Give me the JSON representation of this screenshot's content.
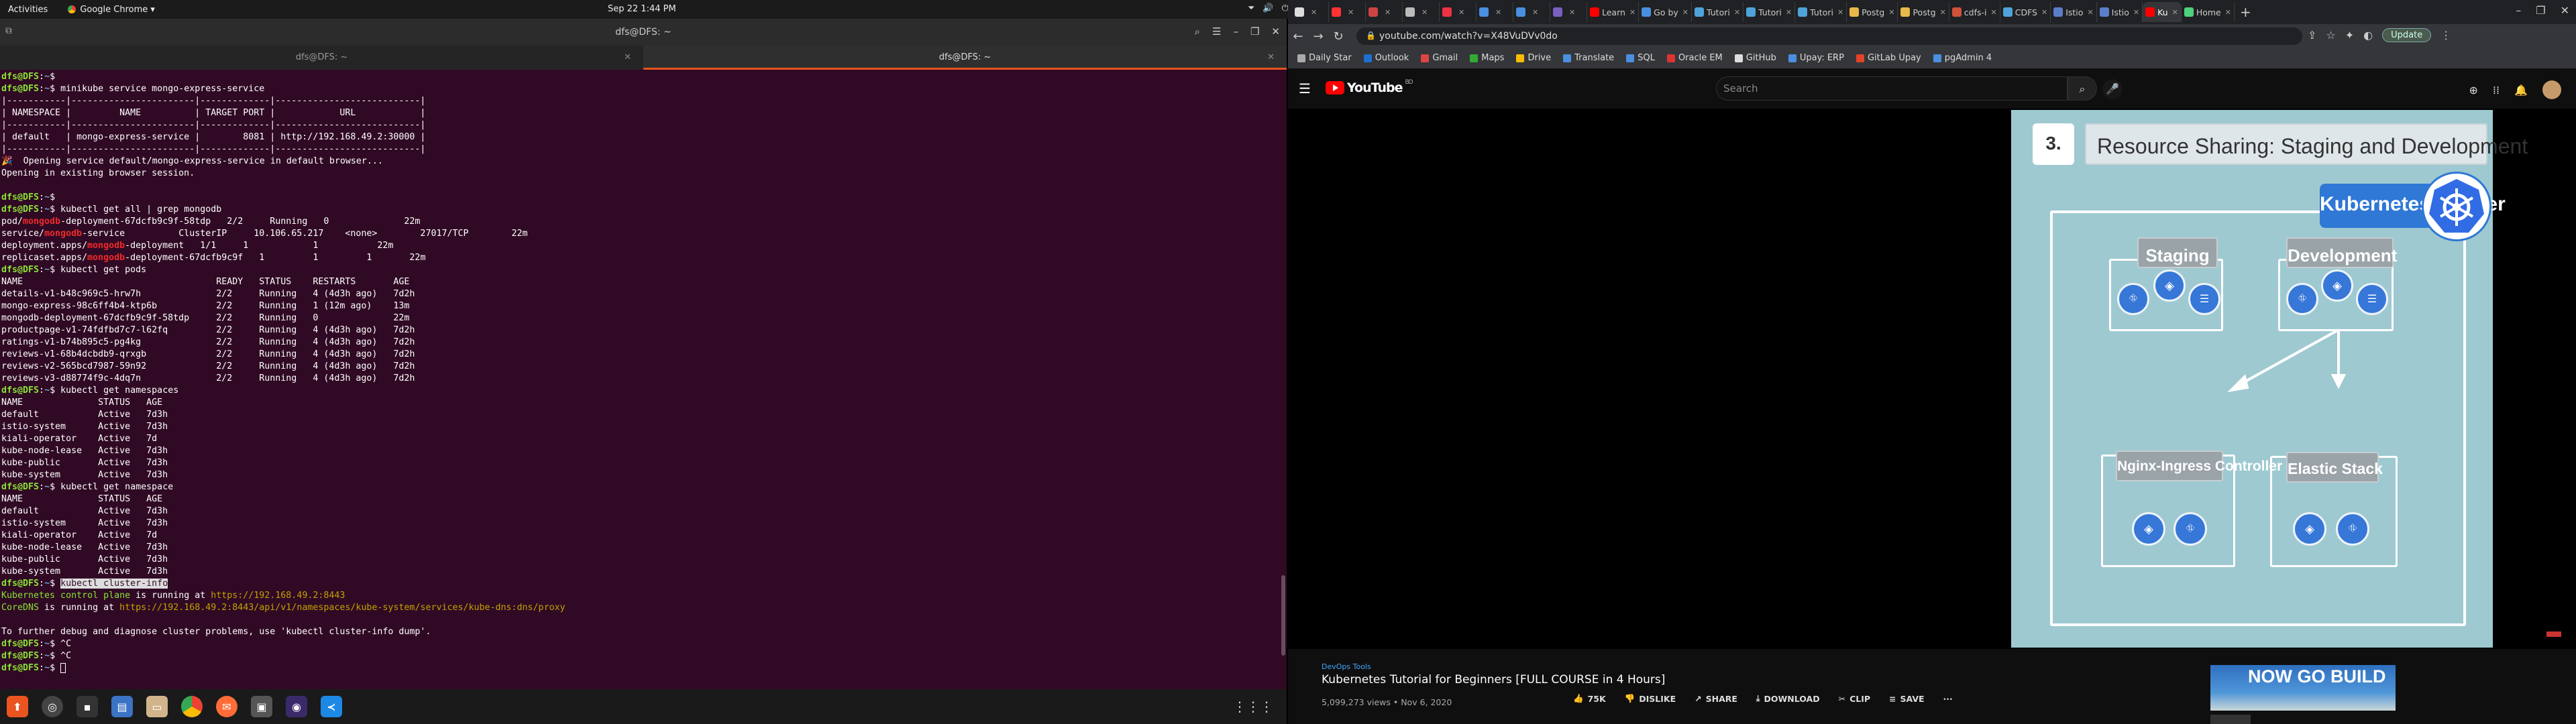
{
  "topbar": {
    "activities": "Activities",
    "app": "Google Chrome ▾",
    "clock": "Sep 22  1:44 PM"
  },
  "terminal": {
    "title": "dfs@DFS: ~",
    "tabs": [
      "dfs@DFS: ~",
      "dfs@DFS: ~"
    ],
    "lines": [
      [
        {
          "t": "dfs@DFS",
          "c": "p"
        },
        {
          "t": ":",
          "c": "pc"
        },
        {
          "t": "~",
          "c": "path"
        },
        {
          "t": "$ ",
          "c": "pc"
        }
      ],
      [
        {
          "t": "dfs@DFS",
          "c": "p"
        },
        {
          "t": ":",
          "c": "pc"
        },
        {
          "t": "~",
          "c": "path"
        },
        {
          "t": "$ minikube service mongo-express-service",
          "c": "pc"
        }
      ],
      [
        {
          "t": "|-----------|-----------------------|-------------|---------------------------|",
          "c": "pc"
        }
      ],
      [
        {
          "t": "| NAMESPACE |         NAME          | TARGET PORT |            URL            |",
          "c": "pc"
        }
      ],
      [
        {
          "t": "|-----------|-----------------------|-------------|---------------------------|",
          "c": "pc"
        }
      ],
      [
        {
          "t": "| default   | mongo-express-service |        8081 | http://192.168.49.2:30000 |",
          "c": "pc"
        }
      ],
      [
        {
          "t": "|-----------|-----------------------|-------------|---------------------------|",
          "c": "pc"
        }
      ],
      [
        {
          "t": "🎉  Opening service default/mongo-express-service in default browser...",
          "c": "pc"
        }
      ],
      [
        {
          "t": "Opening in existing browser session.",
          "c": "pc"
        }
      ],
      [
        {
          "t": "",
          "c": "pc"
        }
      ],
      [
        {
          "t": "dfs@DFS",
          "c": "p"
        },
        {
          "t": ":",
          "c": "pc"
        },
        {
          "t": "~",
          "c": "path"
        },
        {
          "t": "$ ",
          "c": "pc"
        }
      ],
      [
        {
          "t": "dfs@DFS",
          "c": "p"
        },
        {
          "t": ":",
          "c": "pc"
        },
        {
          "t": "~",
          "c": "path"
        },
        {
          "t": "$ kubectl get all | grep mongodb",
          "c": "pc"
        }
      ],
      [
        {
          "t": "pod/",
          "c": "pc"
        },
        {
          "t": "mongodb",
          "c": "red"
        },
        {
          "t": "-deployment-67dcfb9c9f-58tdp   2/2     Running   0              22m",
          "c": "pc"
        }
      ],
      [
        {
          "t": "service/",
          "c": "pc"
        },
        {
          "t": "mongodb",
          "c": "red"
        },
        {
          "t": "-service          ClusterIP     10.106.65.217    <none>        27017/TCP        22m",
          "c": "pc"
        }
      ],
      [
        {
          "t": "deployment.apps/",
          "c": "pc"
        },
        {
          "t": "mongodb",
          "c": "red"
        },
        {
          "t": "-deployment   1/1     1            1           22m",
          "c": "pc"
        }
      ],
      [
        {
          "t": "replicaset.apps/",
          "c": "pc"
        },
        {
          "t": "mongodb",
          "c": "red"
        },
        {
          "t": "-deployment-67dcfb9c9f   1         1         1       22m",
          "c": "pc"
        }
      ],
      [
        {
          "t": "dfs@DFS",
          "c": "p"
        },
        {
          "t": ":",
          "c": "pc"
        },
        {
          "t": "~",
          "c": "path"
        },
        {
          "t": "$ kubectl get pods",
          "c": "pc"
        }
      ],
      [
        {
          "t": "NAME                                    READY   STATUS    RESTARTS       AGE",
          "c": "pc"
        }
      ],
      [
        {
          "t": "details-v1-b48c969c5-hrw7h              2/2     Running   4 (4d3h ago)   7d2h",
          "c": "pc"
        }
      ],
      [
        {
          "t": "mongo-express-98c6ff4b4-ktp6b           2/2     Running   1 (12m ago)    13m",
          "c": "pc"
        }
      ],
      [
        {
          "t": "mongodb-deployment-67dcfb9c9f-58tdp     2/2     Running   0              22m",
          "c": "pc"
        }
      ],
      [
        {
          "t": "productpage-v1-74fdfbd7c7-l62fq         2/2     Running   4 (4d3h ago)   7d2h",
          "c": "pc"
        }
      ],
      [
        {
          "t": "ratings-v1-b74b895c5-pg4kg              2/2     Running   4 (4d3h ago)   7d2h",
          "c": "pc"
        }
      ],
      [
        {
          "t": "reviews-v1-68b4dcbdb9-qrxgb             2/2     Running   4 (4d3h ago)   7d2h",
          "c": "pc"
        }
      ],
      [
        {
          "t": "reviews-v2-565bcd7987-59n92             2/2     Running   4 (4d3h ago)   7d2h",
          "c": "pc"
        }
      ],
      [
        {
          "t": "reviews-v3-d88774f9c-4dq7n              2/2     Running   4 (4d3h ago)   7d2h",
          "c": "pc"
        }
      ],
      [
        {
          "t": "dfs@DFS",
          "c": "p"
        },
        {
          "t": ":",
          "c": "pc"
        },
        {
          "t": "~",
          "c": "path"
        },
        {
          "t": "$ kubectl get namespaces",
          "c": "pc"
        }
      ],
      [
        {
          "t": "NAME              STATUS   AGE",
          "c": "pc"
        }
      ],
      [
        {
          "t": "default           Active   7d3h",
          "c": "pc"
        }
      ],
      [
        {
          "t": "istio-system      Active   7d3h",
          "c": "pc"
        }
      ],
      [
        {
          "t": "kiali-operator    Active   7d",
          "c": "pc"
        }
      ],
      [
        {
          "t": "kube-node-lease   Active   7d3h",
          "c": "pc"
        }
      ],
      [
        {
          "t": "kube-public       Active   7d3h",
          "c": "pc"
        }
      ],
      [
        {
          "t": "kube-system       Active   7d3h",
          "c": "pc"
        }
      ],
      [
        {
          "t": "dfs@DFS",
          "c": "p"
        },
        {
          "t": ":",
          "c": "pc"
        },
        {
          "t": "~",
          "c": "path"
        },
        {
          "t": "$ kubectl get namespace",
          "c": "pc"
        }
      ],
      [
        {
          "t": "NAME              STATUS   AGE",
          "c": "pc"
        }
      ],
      [
        {
          "t": "default           Active   7d3h",
          "c": "pc"
        }
      ],
      [
        {
          "t": "istio-system      Active   7d3h",
          "c": "pc"
        }
      ],
      [
        {
          "t": "kiali-operator    Active   7d",
          "c": "pc"
        }
      ],
      [
        {
          "t": "kube-node-lease   Active   7d3h",
          "c": "pc"
        }
      ],
      [
        {
          "t": "kube-public       Active   7d3h",
          "c": "pc"
        }
      ],
      [
        {
          "t": "kube-system       Active   7d3h",
          "c": "pc"
        }
      ],
      [
        {
          "t": "dfs@DFS",
          "c": "p"
        },
        {
          "t": ":",
          "c": "pc"
        },
        {
          "t": "~",
          "c": "path"
        },
        {
          "t": "$ ",
          "c": "pc"
        },
        {
          "t": "kubectl cluster-info",
          "c": "sel"
        }
      ],
      [
        {
          "t": "Kubernetes control plane",
          "c": "grn"
        },
        {
          "t": " is running at ",
          "c": "pc"
        },
        {
          "t": "https://192.168.49.2:8443",
          "c": "yel"
        }
      ],
      [
        {
          "t": "CoreDNS",
          "c": "grn"
        },
        {
          "t": " is running at ",
          "c": "pc"
        },
        {
          "t": "https://192.168.49.2:8443/api/v1/namespaces/kube-system/services/kube-dns:dns/proxy",
          "c": "yel"
        }
      ],
      [
        {
          "t": "",
          "c": "pc"
        }
      ],
      [
        {
          "t": "To further debug and diagnose cluster problems, use 'kubectl cluster-info dump'.",
          "c": "pc"
        }
      ],
      [
        {
          "t": "dfs@DFS",
          "c": "p"
        },
        {
          "t": ":",
          "c": "pc"
        },
        {
          "t": "~",
          "c": "path"
        },
        {
          "t": "$ ^C",
          "c": "pc"
        }
      ],
      [
        {
          "t": "dfs@DFS",
          "c": "p"
        },
        {
          "t": ":",
          "c": "pc"
        },
        {
          "t": "~",
          "c": "path"
        },
        {
          "t": "$ ^C",
          "c": "pc"
        }
      ],
      [
        {
          "t": "dfs@DFS",
          "c": "p"
        },
        {
          "t": ":",
          "c": "pc"
        },
        {
          "t": "~",
          "c": "path"
        },
        {
          "t": "$ ",
          "c": "pc"
        },
        {
          "t": "",
          "c": "cursor"
        }
      ]
    ]
  },
  "dock": {
    "items": [
      "ubuntu-software-icon",
      "disk-icon",
      "terminal-icon",
      "files-icon",
      "folder-icon",
      "chrome-icon",
      "postman-icon",
      "screenshot-icon",
      "camera-icon",
      "vscode-icon"
    ]
  },
  "browser": {
    "tabs": [
      {
        "label": "",
        "color": "#ddd"
      },
      {
        "label": "",
        "color": "#f33"
      },
      {
        "label": "",
        "color": "#c44"
      },
      {
        "label": "",
        "color": "#bbb"
      },
      {
        "label": "",
        "color": "#e34"
      },
      {
        "label": "",
        "color": "#4a8fe0"
      },
      {
        "label": "",
        "color": "#4a8fe0"
      },
      {
        "label": "",
        "color": "#7a5fc0"
      },
      {
        "label": "Learn",
        "color": "#f00"
      },
      {
        "label": "Go by",
        "color": "#4a8fe0"
      },
      {
        "label": "Tutori",
        "color": "#4fa3d9"
      },
      {
        "label": "Tutori",
        "color": "#4fa3d9"
      },
      {
        "label": "Tutori",
        "color": "#4fa3d9"
      },
      {
        "label": "Postg",
        "color": "#e8b84a"
      },
      {
        "label": "Postg",
        "color": "#e8b84a"
      },
      {
        "label": "cdfs-i",
        "color": "#d0523a"
      },
      {
        "label": "CDFS",
        "color": "#4fa3d9"
      },
      {
        "label": "Istio",
        "color": "#5b7ec9"
      },
      {
        "label": "Istio",
        "color": "#5b7ec9"
      },
      {
        "label": "Ku",
        "color": "#f00",
        "active": true
      },
      {
        "label": "Home",
        "color": "#4fd07a"
      }
    ],
    "url": "youtube.com/watch?v=X48VuDVv0do",
    "update": "Update",
    "bookmarks": [
      {
        "label": "Daily Star",
        "color": "#aaa"
      },
      {
        "label": "Outlook",
        "color": "#1f6fd0"
      },
      {
        "label": "Gmail",
        "color": "#d44"
      },
      {
        "label": "Maps",
        "color": "#3a3"
      },
      {
        "label": "Drive",
        "color": "#fbbc04"
      },
      {
        "label": "Translate",
        "color": "#4a8fe0"
      },
      {
        "label": "SQL",
        "color": "#4a8fe0"
      },
      {
        "label": "Oracle EM",
        "color": "#d33"
      },
      {
        "label": "GitHub",
        "color": "#ddd"
      },
      {
        "label": "Upay: ERP",
        "color": "#4a8fe0"
      },
      {
        "label": "GitLab Upay",
        "color": "#e24329"
      },
      {
        "label": "pgAdmin 4",
        "color": "#4a8fe0"
      }
    ]
  },
  "youtube": {
    "logo": "YouTube",
    "logo_country": "BD",
    "search_placeholder": "Search",
    "slide": {
      "number": "3.",
      "title": "Resource Sharing: Staging and Development",
      "cluster": "Kubernetes Cluster",
      "boxes": [
        "Staging",
        "Development",
        "Nginx-Ingress Controller",
        "Elastic Stack"
      ]
    },
    "channel": "DevOps Tools",
    "video_title": "Kubernetes Tutorial for Beginners [FULL COURSE in 4 Hours]",
    "views": "5,099,273 views • Nov 6, 2020",
    "actions": {
      "like": "75K",
      "dislike": "DISLIKE",
      "share": "SHARE",
      "download": "DOWNLOAD",
      "clip": "CLIP",
      "save": "SAVE",
      "more": "···"
    },
    "ad_text": "NOW GO BUILD"
  }
}
